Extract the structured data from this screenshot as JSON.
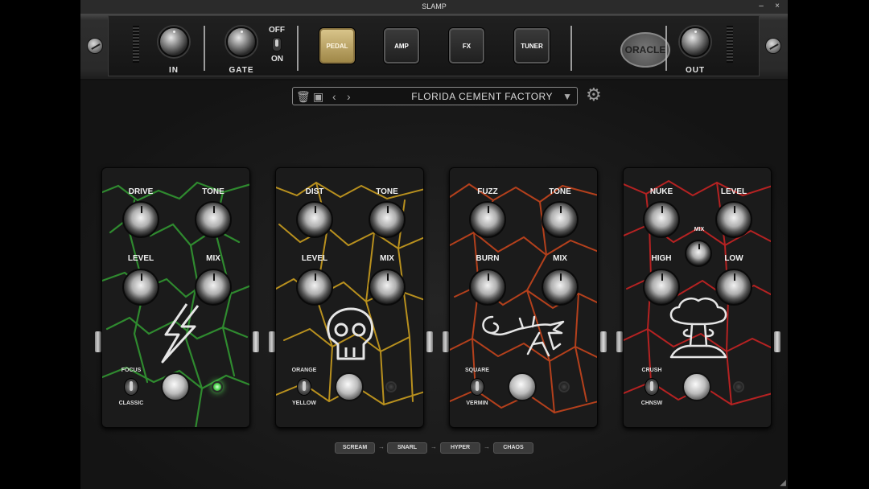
{
  "window": {
    "title": "SLAMP",
    "minimize": "–",
    "close": "×"
  },
  "rack": {
    "in_label": "IN",
    "gate_label": "GATE",
    "gate_off": "OFF",
    "gate_on": "ON",
    "out_label": "OUT",
    "modes": [
      {
        "label": "PEDAL",
        "active": true
      },
      {
        "label": "AMP"
      },
      {
        "label": "FX"
      },
      {
        "label": "TUNER"
      }
    ],
    "logo": "ORACLE"
  },
  "preset": {
    "name": "FLORIDA CEMENT FACTORY"
  },
  "pedals": [
    {
      "name": "scream",
      "crack_color": "#2f8a2f",
      "labels": [
        "DRIVE",
        "TONE",
        "LEVEL",
        "MIX"
      ],
      "switch_top": "FOCUS",
      "switch_bottom": "CLASSIC",
      "icon": "lightning-bolt-icon",
      "led_on": true
    },
    {
      "name": "snarl",
      "crack_color": "#b8901e",
      "labels": [
        "DIST",
        "TONE",
        "LEVEL",
        "MIX"
      ],
      "switch_top": "ORANGE",
      "switch_bottom": "YELLOW",
      "icon": "skull-icon",
      "led_on": false
    },
    {
      "name": "hyper",
      "crack_color": "#b4401c",
      "labels": [
        "FUZZ",
        "TONE",
        "BURN",
        "MIX"
      ],
      "switch_top": "SQUARE",
      "switch_bottom": "VERMIN",
      "icon": "lizard-icon",
      "led_on": false
    },
    {
      "name": "chaos",
      "crack_color": "#b52222",
      "labels": [
        "NUKE",
        "LEVEL",
        "HIGH",
        "LOW"
      ],
      "mix_label": "MIX",
      "switch_top": "CRUSH",
      "switch_bottom": "CHNSW",
      "icon": "mushroom-cloud-icon",
      "led_on": false
    }
  ],
  "chain": [
    "SCREAM",
    "SNARL",
    "HYPER",
    "CHAOS"
  ]
}
